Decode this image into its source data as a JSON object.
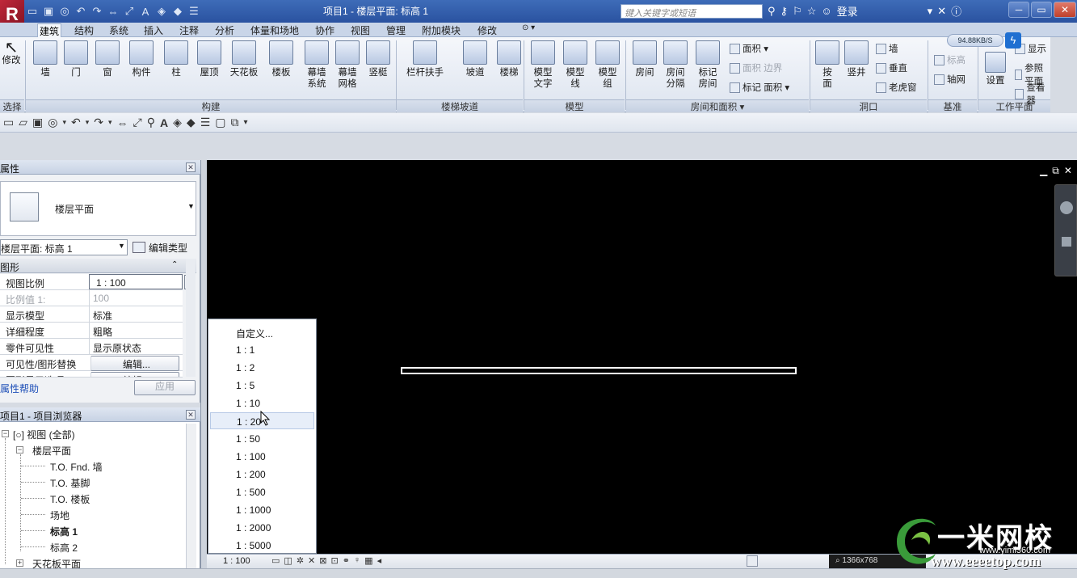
{
  "window": {
    "title": "项目1 - 楼层平面: 标高 1",
    "help_search_placeholder": "键入关键字或短语",
    "login_label": "登录",
    "logo_glyph": "R"
  },
  "ribbon_tabs": [
    "建筑",
    "结构",
    "系统",
    "插入",
    "注释",
    "分析",
    "体量和场地",
    "协作",
    "视图",
    "管理",
    "附加模块",
    "修改"
  ],
  "active_tab": "建筑",
  "ribbon": {
    "modify": "修改",
    "select_panel": "选择",
    "build_buttons": [
      {
        "label": "墙",
        "icon": "wall-icon"
      },
      {
        "label": "门",
        "icon": "door-icon"
      },
      {
        "label": "窗",
        "icon": "window-icon"
      },
      {
        "label": "构件",
        "icon": "component-icon"
      },
      {
        "label": "柱",
        "icon": "column-icon"
      },
      {
        "label": "屋顶",
        "icon": "roof-icon"
      },
      {
        "label": "天花板",
        "icon": "ceiling-icon"
      },
      {
        "label": "楼板",
        "icon": "floor-icon"
      },
      {
        "label": "幕墙\n系统",
        "icon": "curtain-system-icon"
      },
      {
        "label": "幕墙\n网格",
        "icon": "curtain-grid-icon"
      },
      {
        "label": "竖梃",
        "icon": "mullion-icon"
      }
    ],
    "build_panel": "构建",
    "stair_buttons": [
      {
        "label": "栏杆扶手",
        "icon": "railing-icon"
      },
      {
        "label": "坡道",
        "icon": "ramp-icon"
      },
      {
        "label": "楼梯",
        "icon": "stair-icon"
      }
    ],
    "stair_panel": "楼梯坡道",
    "model_buttons": [
      {
        "label": "模型\n文字",
        "icon": "model-text-icon"
      },
      {
        "label": "模型\n线",
        "icon": "model-line-icon"
      },
      {
        "label": "模型\n组",
        "icon": "model-group-icon"
      }
    ],
    "model_panel": "模型",
    "room_buttons": [
      {
        "label": "房间",
        "icon": "room-icon"
      },
      {
        "label": "房间\n分隔",
        "icon": "room-separator-icon"
      },
      {
        "label": "标记\n房间",
        "icon": "tag-room-icon"
      }
    ],
    "room_small": [
      {
        "label": "面积 ▾",
        "disabled": false
      },
      {
        "label": "面积  边界",
        "disabled": true
      },
      {
        "label": "标记  面积 ▾",
        "disabled": false
      }
    ],
    "room_panel": "房间和面积 ▾",
    "opening_buttons": [
      {
        "label": "按\n面",
        "icon": "by-face-icon"
      },
      {
        "label": "竖井",
        "icon": "shaft-icon"
      }
    ],
    "opening_small": [
      "墙",
      "垂直",
      "老虎窗"
    ],
    "opening_panel": "洞口",
    "datum_small": [
      "标高",
      "轴网"
    ],
    "datum_panel": "基准",
    "work_small": [
      "显示",
      "参照 平面",
      "查看器"
    ],
    "work_button": "设置",
    "work_panel": "工作平面",
    "speed": "94.88KB/S"
  },
  "properties": {
    "title": "属性",
    "type_name": "楼层平面",
    "view_selector": "楼层平面: 标高 1",
    "edit_type": "编辑类型",
    "group": "图形",
    "rows": [
      {
        "k": "视图比例",
        "v": "1 : 100",
        "disabled": false
      },
      {
        "k": "比例值 1:",
        "v": "100",
        "disabled": true
      },
      {
        "k": "显示模型",
        "v": "标准",
        "disabled": false
      },
      {
        "k": "详细程度",
        "v": "粗略",
        "disabled": false
      },
      {
        "k": "零件可见性",
        "v": "显示原状态",
        "disabled": false
      },
      {
        "k": "可见性/图形替换",
        "v": "编辑...",
        "disabled": false
      },
      {
        "k": "图形显示选项",
        "v": "编辑...",
        "disabled": false
      }
    ],
    "help": "属性帮助",
    "apply": "应用"
  },
  "browser": {
    "title": "项目1 - 项目浏览器",
    "root": "视图 (全部)",
    "floor_plans": "楼层平面",
    "items": [
      "T.O. Fnd. 墙",
      "T.O. 基脚",
      "T.O. 楼板",
      "场地",
      "标高 1",
      "标高 2"
    ],
    "active_item": "标高 1",
    "ceiling_plans": "天花板平面"
  },
  "scale_menu": {
    "options": [
      "自定义...",
      "1 : 1",
      "1 : 2",
      "1 : 5",
      "1 : 10",
      "1 : 20",
      "1 : 50",
      "1 : 100",
      "1 : 200",
      "1 : 500",
      "1 : 1000",
      "1 : 2000",
      "1 : 5000"
    ],
    "hover": "1 : 20"
  },
  "view_control": {
    "scale": "1 : 100",
    "zoom": "1366x768"
  },
  "watermark": {
    "brand": "一米网校",
    "url_small": "www.yimi360.com",
    "url_big": "www.eeeetop.com"
  }
}
